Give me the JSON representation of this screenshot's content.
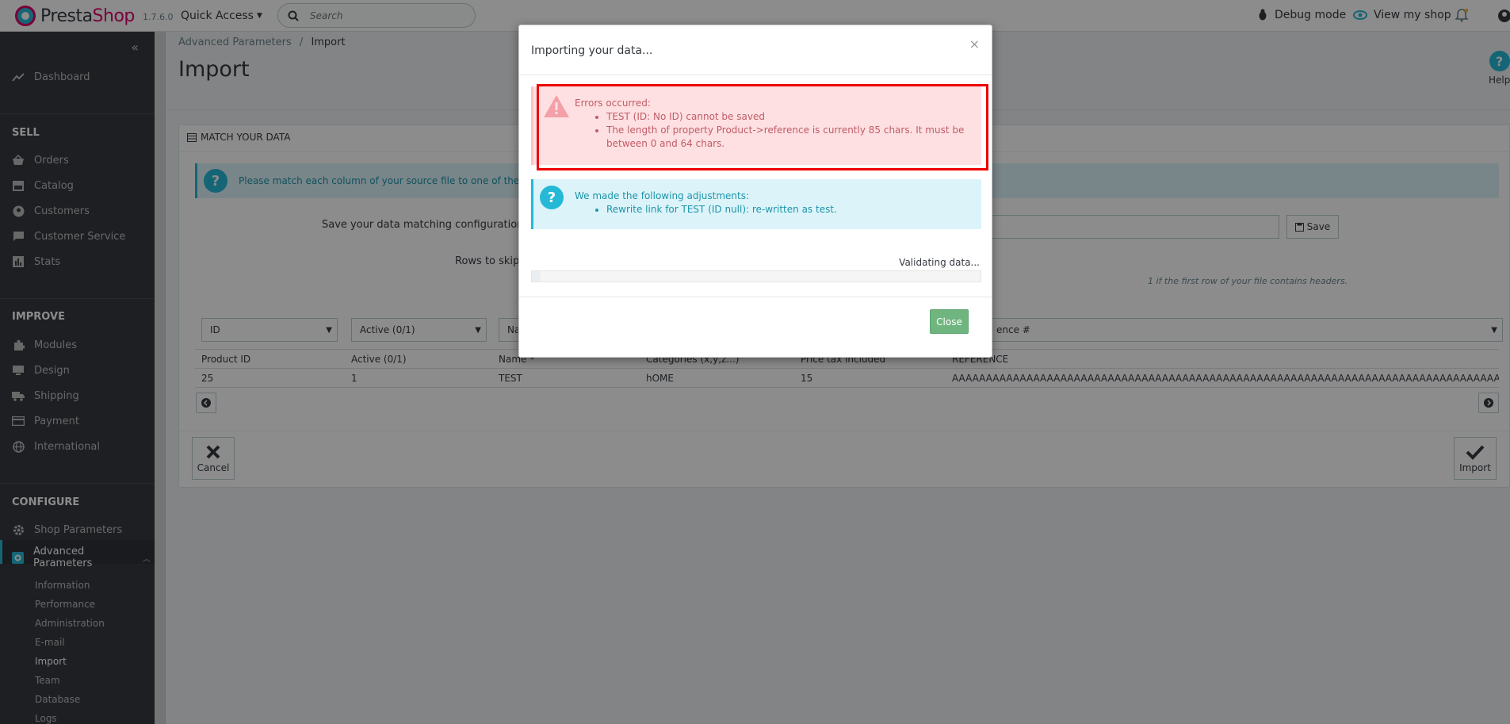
{
  "header": {
    "logo_prefix": "Presta",
    "logo_suffix": "Shop",
    "version": "1.7.6.0",
    "quick_access": "Quick Access",
    "search_placeholder": "Search",
    "debug_mode": "Debug mode",
    "view_shop": "View my shop"
  },
  "sidebar": {
    "dashboard": "Dashboard",
    "sell": "SELL",
    "orders": "Orders",
    "catalog": "Catalog",
    "customers": "Customers",
    "customer_service": "Customer Service",
    "stats": "Stats",
    "improve": "IMPROVE",
    "modules": "Modules",
    "design": "Design",
    "shipping": "Shipping",
    "payment": "Payment",
    "international": "International",
    "configure": "CONFIGURE",
    "shop_parameters": "Shop Parameters",
    "advanced_parameters": "Advanced Parameters",
    "subs": [
      "Information",
      "Performance",
      "Administration",
      "E-mail",
      "Import",
      "Team",
      "Database",
      "Logs"
    ]
  },
  "page": {
    "breadcrumb_parent": "Advanced Parameters",
    "breadcrumb_sep": "/",
    "breadcrumb_current": "Import",
    "title": "Import",
    "help": "Help",
    "panel_title": "MATCH YOUR DATA",
    "info": "Please match each column of your source file to one of the desti",
    "save_config_label": "Save your data matching configuration",
    "save": "Save",
    "rows_skip_label": "Rows to skip",
    "rows_hint": "1 if the first row of your file contains headers.",
    "selects": [
      "ID",
      "Active (0/1)",
      "Na",
      "ence #"
    ],
    "headers": [
      "Product ID",
      "Active (0/1)",
      "Name *",
      "Categories (x,y,z...)",
      "Price tax included",
      "REFERENCE"
    ],
    "row": [
      "25",
      "1",
      "TEST",
      "hOME",
      "15",
      "AAAAAAAAAAAAAAAAAAAAAAAAAAAAAAAAAAAAAAAAAAAAAAAAAAAAAAAAAAAAAAAAAAAAAAAAAAAAAAAAA"
    ],
    "cancel": "Cancel",
    "import": "Import"
  },
  "modal": {
    "title": "Importing your data...",
    "close_x": "×",
    "errors_title": "Errors occurred:",
    "errors": [
      "TEST (ID: No ID) cannot be saved",
      "The length of property Product->reference is currently 85 chars. It must be between 0 and 64 chars."
    ],
    "adjust_title": "We made the following adjustments:",
    "adjustments": [
      "Rewrite link for TEST (ID null): re-written as test."
    ],
    "validating": "Validating data...",
    "progress": 0.02,
    "close": "Close"
  }
}
